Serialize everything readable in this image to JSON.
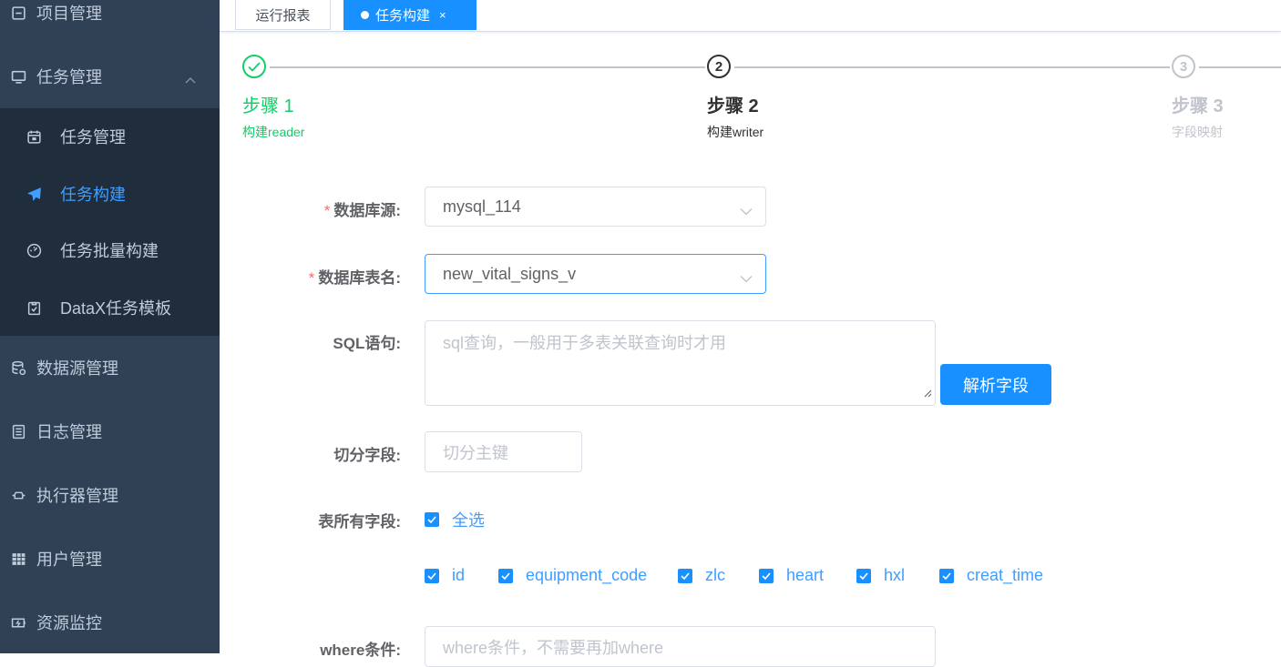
{
  "sidebar": {
    "items": [
      {
        "label": "项目管理",
        "icon": "project-icon"
      },
      {
        "label": "任务管理",
        "icon": "monitor-icon"
      },
      {
        "label": "数据源管理",
        "icon": "database-icon"
      },
      {
        "label": "日志管理",
        "icon": "document-icon"
      },
      {
        "label": "执行器管理",
        "icon": "executor-icon"
      },
      {
        "label": "用户管理",
        "icon": "user-table-icon"
      },
      {
        "label": "资源监控",
        "icon": "battery-icon"
      }
    ],
    "submenu": [
      {
        "label": "任务管理",
        "icon": "calendar-icon"
      },
      {
        "label": "任务构建",
        "icon": "paper-plane-icon",
        "active": true
      },
      {
        "label": "任务批量构建",
        "icon": "dashboard-icon"
      },
      {
        "label": "DataX任务模板",
        "icon": "clipboard-icon"
      }
    ]
  },
  "tags": [
    {
      "label": "运行报表"
    },
    {
      "label": "任务构建",
      "active": true,
      "close": "×"
    }
  ],
  "steps": [
    {
      "title": "步骤 1",
      "desc": "构建reader",
      "status": "finished"
    },
    {
      "title": "步骤 2",
      "desc": "构建writer",
      "status": "process",
      "number": "2"
    },
    {
      "title": "步骤 3",
      "desc": "字段映射",
      "status": "wait",
      "number": "3"
    }
  ],
  "form": {
    "required_mark": "*",
    "datasource": {
      "label": "数据库源:",
      "value": "mysql_114"
    },
    "table": {
      "label": "数据库表名:",
      "value": "new_vital_signs_v"
    },
    "sql": {
      "label": "SQL语句:",
      "placeholder": "sql查询，一般用于多表关联查询时才用"
    },
    "parse_button": "解析字段",
    "split": {
      "label": "切分字段:",
      "placeholder": "切分主键"
    },
    "fields": {
      "label": "表所有字段:",
      "select_all": "全选",
      "columns": [
        "id",
        "equipment_code",
        "zlc",
        "heart",
        "hxl",
        "creat_time"
      ]
    },
    "where": {
      "label": "where条件:",
      "placeholder": "where条件，不需要再加where"
    }
  },
  "colors": {
    "sidebar_bg": "#304156",
    "submenu_bg": "#1f2d3d",
    "primary": "#1890ff",
    "success": "#13ce66"
  }
}
